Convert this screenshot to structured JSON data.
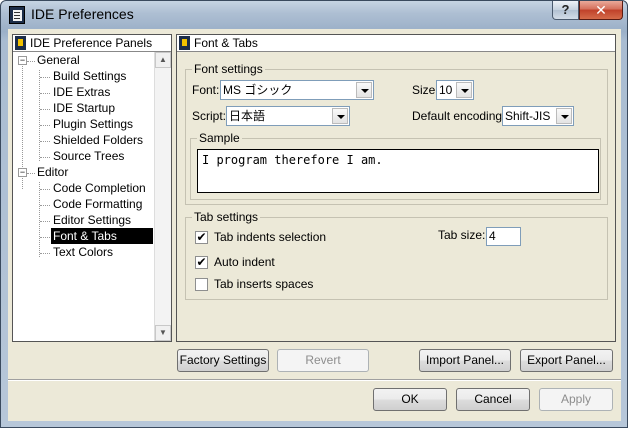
{
  "window": {
    "title": "IDE Preferences",
    "help_symbol": "?",
    "close_symbol": "✕",
    "app_icon": "ide-app-icon"
  },
  "tree": {
    "header": "IDE Preference Panels",
    "expand_symbol": "−",
    "groups": [
      {
        "label": "General",
        "children": [
          "Build Settings",
          "IDE Extras",
          "IDE Startup",
          "Plugin Settings",
          "Shielded Folders",
          "Source Trees"
        ]
      },
      {
        "label": "Editor",
        "children": [
          "Code Completion",
          "Code Formatting",
          "Editor Settings",
          "Font & Tabs",
          "Text Colors"
        ]
      }
    ],
    "selected": "Font & Tabs",
    "scroll_up": "▲",
    "scroll_down": "▼"
  },
  "panel": {
    "header": "Font & Tabs",
    "font_settings": {
      "title": "Font settings",
      "font_label": "Font:",
      "font_value": "MS ゴシック",
      "size_label": "Size:",
      "size_value": "10",
      "script_label": "Script:",
      "script_value": "日本語",
      "encoding_label": "Default encoding:",
      "encoding_value": "Shift-JIS",
      "sample_title": "Sample",
      "sample_text": "I program therefore I am."
    },
    "tab_settings": {
      "title": "Tab settings",
      "check_mark": "✔",
      "tab_indents_label": "Tab indents selection",
      "tab_indents_checked": true,
      "auto_indent_label": "Auto indent",
      "auto_indent_checked": true,
      "tab_spaces_label": "Tab inserts spaces",
      "tab_spaces_checked": false,
      "tab_size_label": "Tab size:",
      "tab_size_value": "4"
    }
  },
  "buttons": {
    "factory": "Factory Settings",
    "revert": "Revert",
    "import": "Import Panel...",
    "export": "Export Panel...",
    "ok": "OK",
    "cancel": "Cancel",
    "apply": "Apply"
  }
}
